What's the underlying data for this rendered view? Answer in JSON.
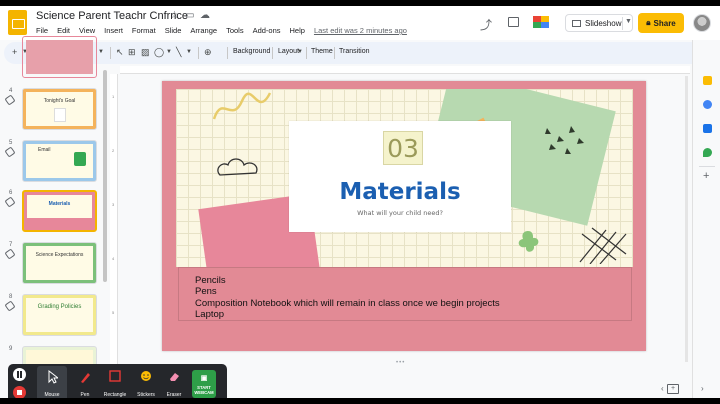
{
  "app": {
    "title": "Science Parent Teachr Cnfrnce",
    "menu": [
      "File",
      "Edit",
      "View",
      "Insert",
      "Format",
      "Slide",
      "Arrange",
      "Tools",
      "Add-ons",
      "Help"
    ],
    "last_edit": "Last edit was 2 minutes ago",
    "slideshow_label": "Slideshow",
    "share_label": "Share",
    "brand_color": "#f4b400"
  },
  "toolbar": {
    "background_label": "Background",
    "layout_label": "Layout",
    "theme_label": "Theme",
    "transition_label": "Transition"
  },
  "filmstrip": {
    "slides": [
      {
        "number": "",
        "text": ""
      },
      {
        "number": "4",
        "text": "Tonight's Goal"
      },
      {
        "number": "5",
        "text": "Email"
      },
      {
        "number": "6",
        "text": "Materials"
      },
      {
        "number": "7",
        "text": "Science Expectations"
      },
      {
        "number": "8",
        "text": "Grading Policies"
      },
      {
        "number": "9",
        "text": ""
      }
    ],
    "selected_index": 3
  },
  "slide": {
    "section_number": "03",
    "title": "Materials",
    "subtitle": "What will your child need?",
    "bullets": [
      "Pencils",
      "Pens",
      "Composition Notebook which will remain in class once we begin projects",
      "Laptop"
    ],
    "background_color": "#e28a95",
    "title_color": "#1b5fb1"
  },
  "ruler": {
    "marks": [
      "1",
      "2",
      "3",
      "4",
      "5"
    ]
  },
  "screencast": {
    "tools": [
      {
        "label": "Mouse",
        "icon": "cursor-icon"
      },
      {
        "label": "Pen",
        "icon": "pen-icon"
      },
      {
        "label": "Rectangle",
        "icon": "rectangle-icon"
      },
      {
        "label": "Stickers",
        "icon": "sticker-icon"
      },
      {
        "label": "Eraser",
        "icon": "eraser-icon"
      }
    ],
    "webcam_line1": "START",
    "webcam_line2": "WEBCAM"
  }
}
